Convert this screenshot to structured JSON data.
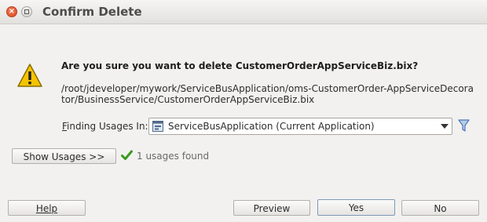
{
  "window": {
    "title": "Confirm Delete"
  },
  "dialog": {
    "question": "Are you sure you want to delete CustomerOrderAppServiceBiz.bix?",
    "path": "/root/jdeveloper/mywork/ServiceBusApplication/oms-CustomerOrder-AppServiceDecorator/BusinessService/CustomerOrderAppServiceBiz.bix",
    "finding_usages_label": "Finding Usages In:",
    "finding_usages_value": "ServiceBusApplication (Current Application)",
    "show_usages_label": "Show Usages >>",
    "usages_found": "1 usages found"
  },
  "buttons": {
    "help": "Help",
    "preview": "Preview",
    "yes": "Yes",
    "no": "No"
  },
  "icons": {
    "warning": "warning-icon",
    "close": "close-icon",
    "maximize": "maximize-icon",
    "application": "application-icon",
    "filter": "filter-icon",
    "check": "check-icon"
  },
  "colors": {
    "warning": "#f5c400",
    "check": "#3a9a1e",
    "filter": "#4a78b8",
    "close": "#e2582b"
  }
}
